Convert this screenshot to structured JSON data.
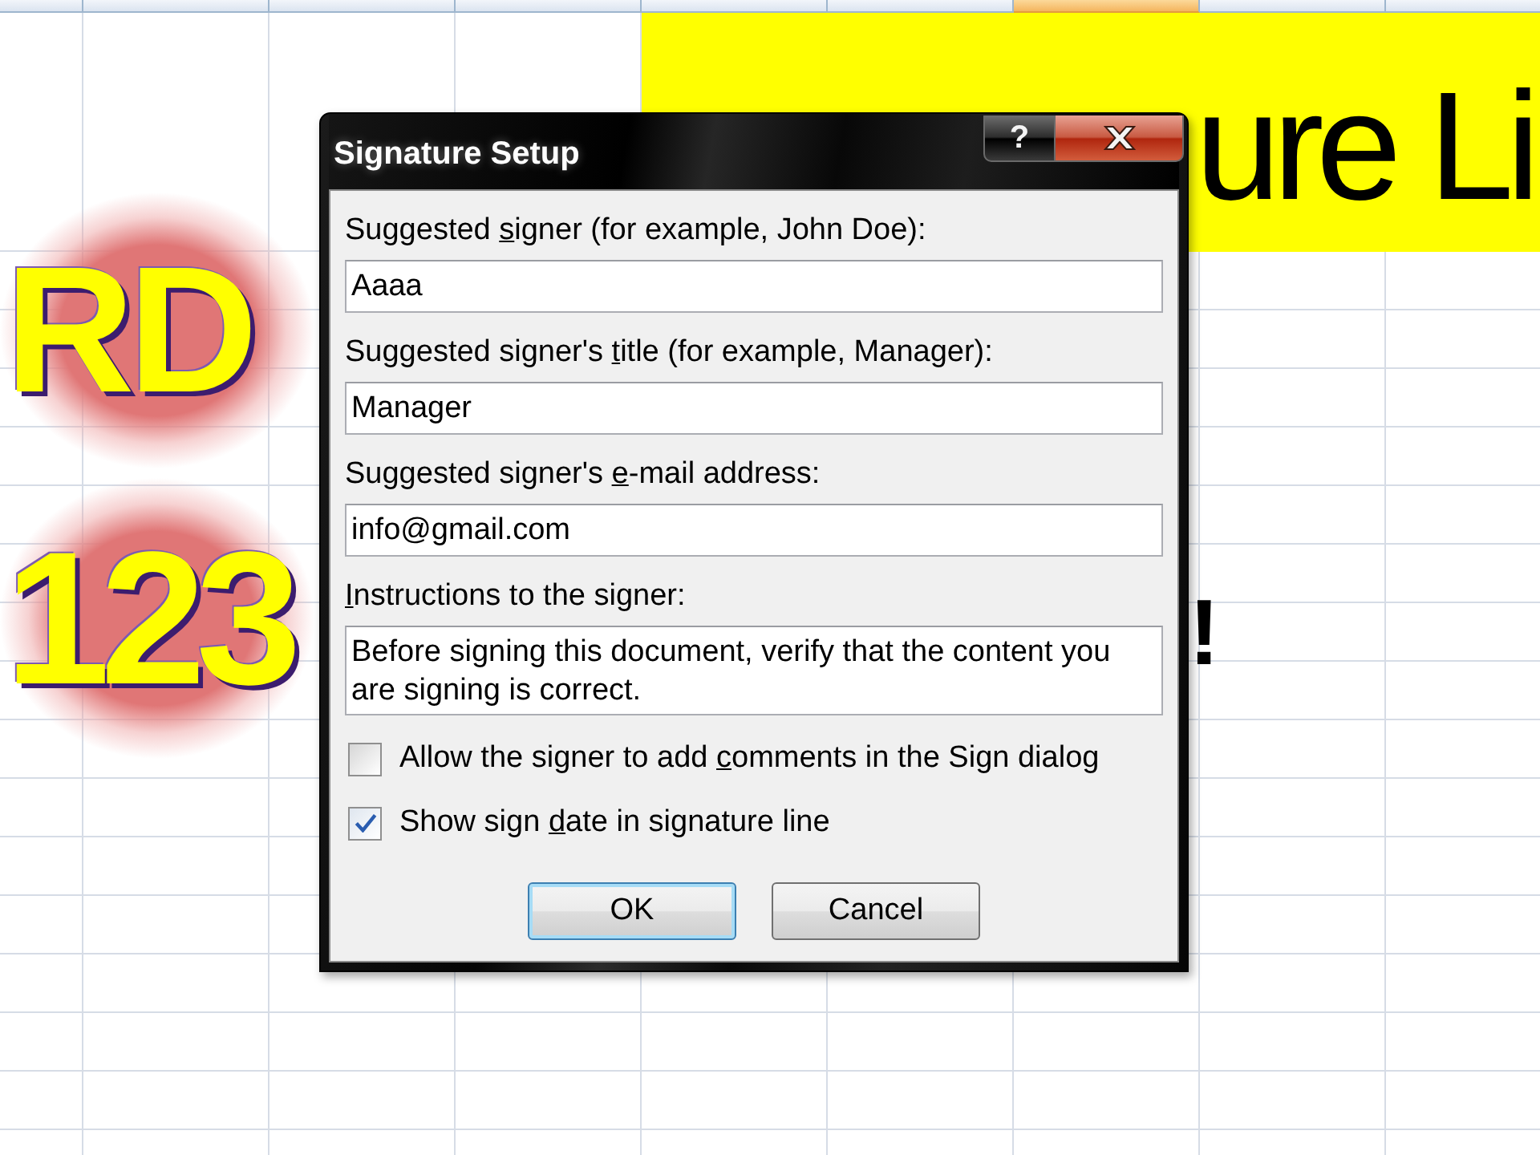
{
  "sheet": {
    "column_headers": [
      {
        "selected": false
      },
      {
        "selected": false
      },
      {
        "selected": false
      },
      {
        "selected": false
      },
      {
        "selected": false
      },
      {
        "selected": false
      },
      {
        "selected": true
      },
      {
        "selected": false
      },
      {
        "selected": false
      }
    ],
    "banner": {
      "text": "ure Li"
    },
    "wordart": [
      {
        "text": "RD"
      },
      {
        "text": "123"
      }
    ],
    "cell_text": "!"
  },
  "dialog": {
    "title": "Signature Setup",
    "help_button": "?",
    "fields": [
      {
        "kind": "single",
        "label": {
          "before": "Suggested ",
          "key": "s",
          "after": "igner (for example, John Doe):"
        },
        "value": "Aaaa"
      },
      {
        "kind": "single",
        "label": {
          "before": "Suggested signer's ",
          "key": "t",
          "after": "itle (for example, Manager):"
        },
        "value": "Manager"
      },
      {
        "kind": "single",
        "label": {
          "before": "Suggested signer's ",
          "key": "e",
          "after": "-mail address:"
        },
        "value": "info@gmail.com"
      },
      {
        "kind": "multi",
        "label": {
          "key": "I",
          "after": "nstructions to the signer:"
        },
        "value": "Before signing this document, verify that the content you are signing is correct."
      }
    ],
    "checkboxes": [
      {
        "label": {
          "before": "Allow the signer to add ",
          "key": "c",
          "after": "omments in the Sign dialog"
        },
        "checked": false
      },
      {
        "label": {
          "before": "Show sign ",
          "key": "d",
          "after": "ate in signature line"
        },
        "checked": true
      }
    ],
    "buttons": [
      {
        "label": "OK",
        "default": true
      },
      {
        "label": "Cancel",
        "default": false
      }
    ]
  }
}
